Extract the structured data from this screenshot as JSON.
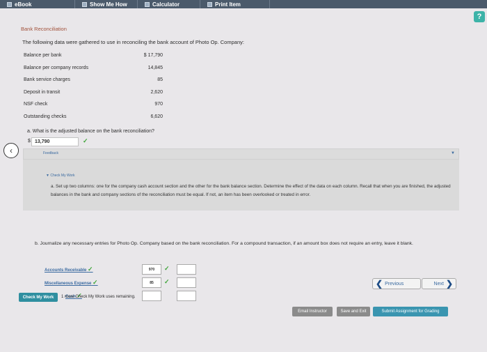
{
  "toolbar": {
    "ebook": "eBook",
    "show_me_how": "Show Me How",
    "calculator": "Calculator",
    "print_item": "Print Item"
  },
  "help_label": "?",
  "section_title": "Bank Reconciliation",
  "intro": "The following data were gathered to use in reconciling the bank account of Photo Op. Company:",
  "data_rows": [
    {
      "label": "Balance per bank",
      "value": "$ 17,790"
    },
    {
      "label": "Balance per company records",
      "value": "14,845"
    },
    {
      "label": "Bank service charges",
      "value": "85"
    },
    {
      "label": "Deposit in transit",
      "value": "2,620"
    },
    {
      "label": "NSF check",
      "value": "970"
    },
    {
      "label": "Outstanding checks",
      "value": "6,620"
    }
  ],
  "question_a": "a.  What is the adjusted balance on the bank reconciliation?",
  "dollar_sign": "$",
  "answer_a": "13,790",
  "check_mark": "✓",
  "feedback": {
    "bar_label": "Feedback",
    "heading": "▼ Check My Work",
    "text": "a. Set up two columns: one for the company cash account section and the other for the bank balance section. Determine the effect of the data on each column. Recall that when you are finished, the adjusted balances in the bank and company sections of the reconciliation must be equal. If not, an item has been overlooked or treated in error."
  },
  "question_b": "b.  Journalize any necessary entries for Photo Op. Company based on the bank reconciliation. For a compound transaction, if an amount box does not require an entry, leave it blank.",
  "journal": [
    {
      "account": "Accounts Receivable",
      "debit": "970",
      "credit": ""
    },
    {
      "account": "Miscellaneous Expense",
      "debit": "85",
      "credit": ""
    },
    {
      "account": "Cash",
      "debit": "",
      "credit": ""
    }
  ],
  "nav": {
    "previous": "Previous",
    "next": "Next"
  },
  "check_my_work": "Check My Work",
  "remaining_text": "1 more Check My Work uses remaining.",
  "footer": {
    "email": "Email Instructor",
    "save": "Save and Exit",
    "submit": "Submit Assignment for Grading"
  }
}
